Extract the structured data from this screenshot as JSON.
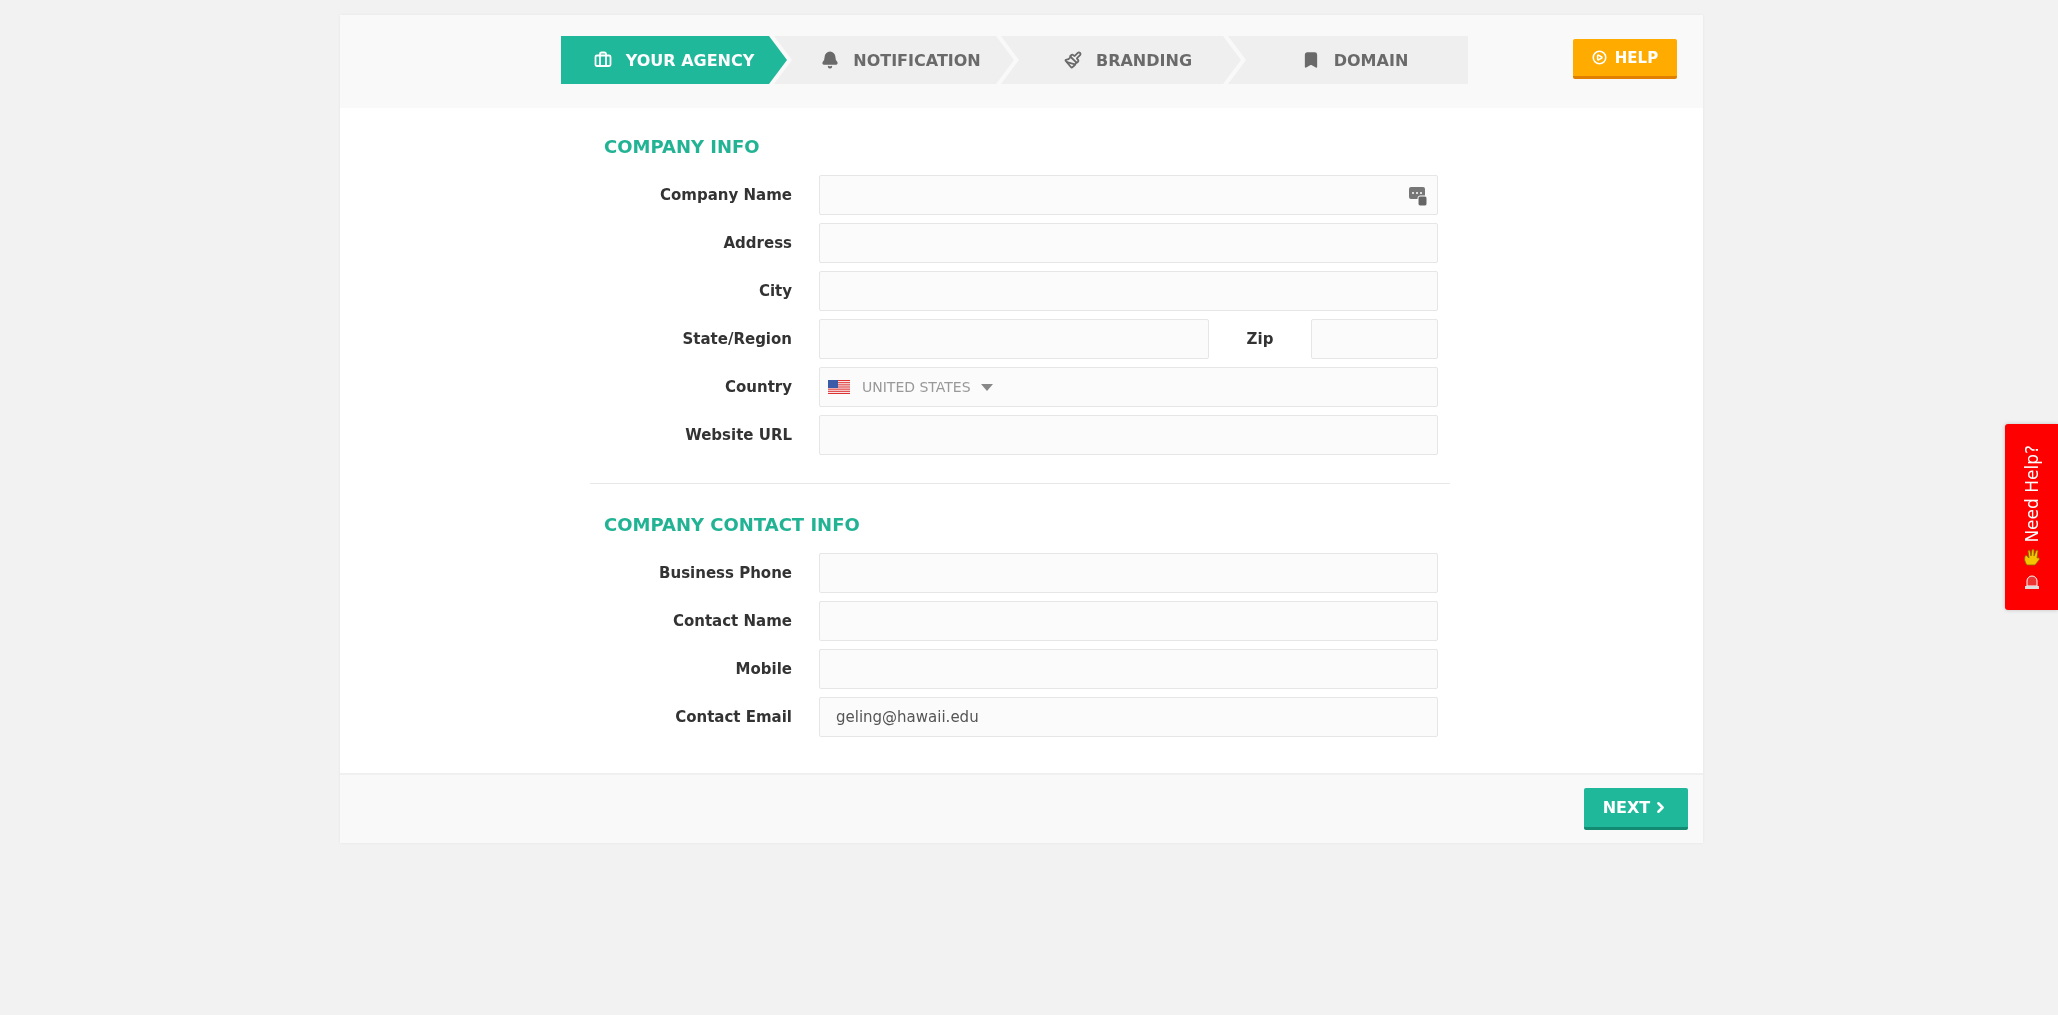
{
  "steps": [
    {
      "label": "YOUR AGENCY",
      "kind": "briefcase",
      "selected": true
    },
    {
      "label": "NOTIFICATION",
      "kind": "bell",
      "selected": false
    },
    {
      "label": "BRANDING",
      "kind": "brush",
      "selected": false
    },
    {
      "label": "DOMAIN",
      "kind": "bookmark",
      "selected": false
    }
  ],
  "help_button": "HELP",
  "sections": [
    {
      "title": "COMPANY INFO",
      "fields": [
        {
          "kind": "text",
          "label": "Company Name",
          "autofill_icon": true
        },
        {
          "kind": "text",
          "label": "Address"
        },
        {
          "kind": "text",
          "label": "City"
        },
        {
          "kind": "split",
          "label": "State/Region",
          "second_label": "Zip"
        },
        {
          "kind": "select",
          "label": "Country",
          "value": "UNITED STATES"
        },
        {
          "kind": "text",
          "label": "Website URL"
        }
      ]
    },
    {
      "title": "COMPANY CONTACT INFO",
      "fields": [
        {
          "kind": "text",
          "label": "Business Phone"
        },
        {
          "kind": "text",
          "label": "Contact Name"
        },
        {
          "kind": "text",
          "label": "Mobile"
        },
        {
          "kind": "text",
          "label": "Contact Email",
          "value": "geling@hawaii.edu"
        }
      ]
    }
  ],
  "next_button": "NEXT",
  "side_tab": "Need Help?"
}
